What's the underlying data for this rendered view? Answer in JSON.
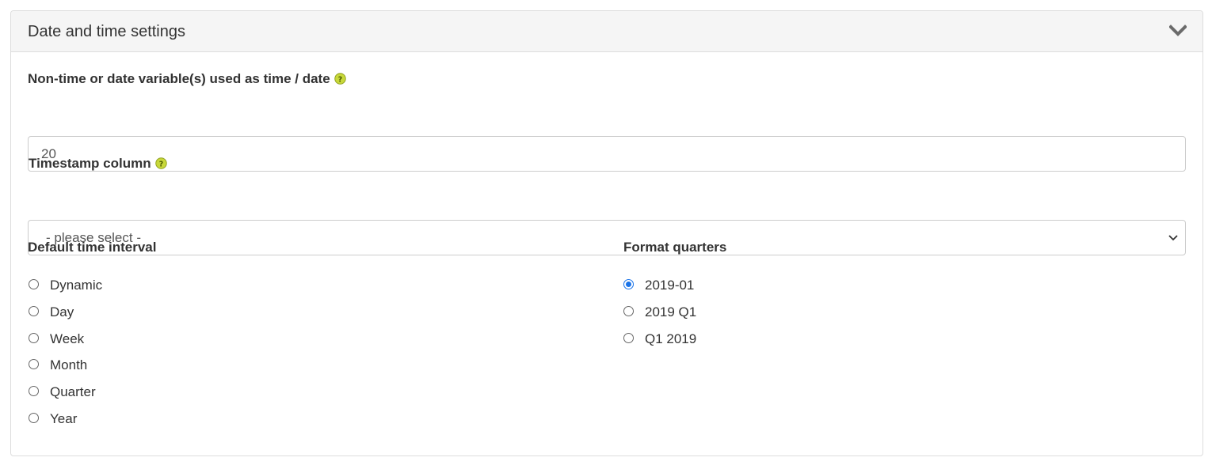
{
  "panel": {
    "title": "Date and time settings",
    "collapse_icon": "chevron-down-icon"
  },
  "non_time_field": {
    "label": "Non-time or date variable(s) used as time / date",
    "value": "20",
    "help_icon": "help-icon"
  },
  "timestamp_field": {
    "label": "Timestamp column",
    "selected": "- please select -",
    "help_icon": "help-icon",
    "caret_icon": "chevron-down-icon"
  },
  "default_interval": {
    "label": "Default time interval",
    "options": [
      "Dynamic",
      "Day",
      "Week",
      "Month",
      "Quarter",
      "Year"
    ],
    "selected_index": null
  },
  "format_quarters": {
    "label": "Format quarters",
    "options": [
      "2019-01",
      "2019 Q1",
      "Q1 2019"
    ],
    "selected_index": 0
  },
  "colors": {
    "help_icon_fill": "#c8d83a",
    "radio_checked": "#1a73e8",
    "heading_bg": "#f5f5f5"
  }
}
